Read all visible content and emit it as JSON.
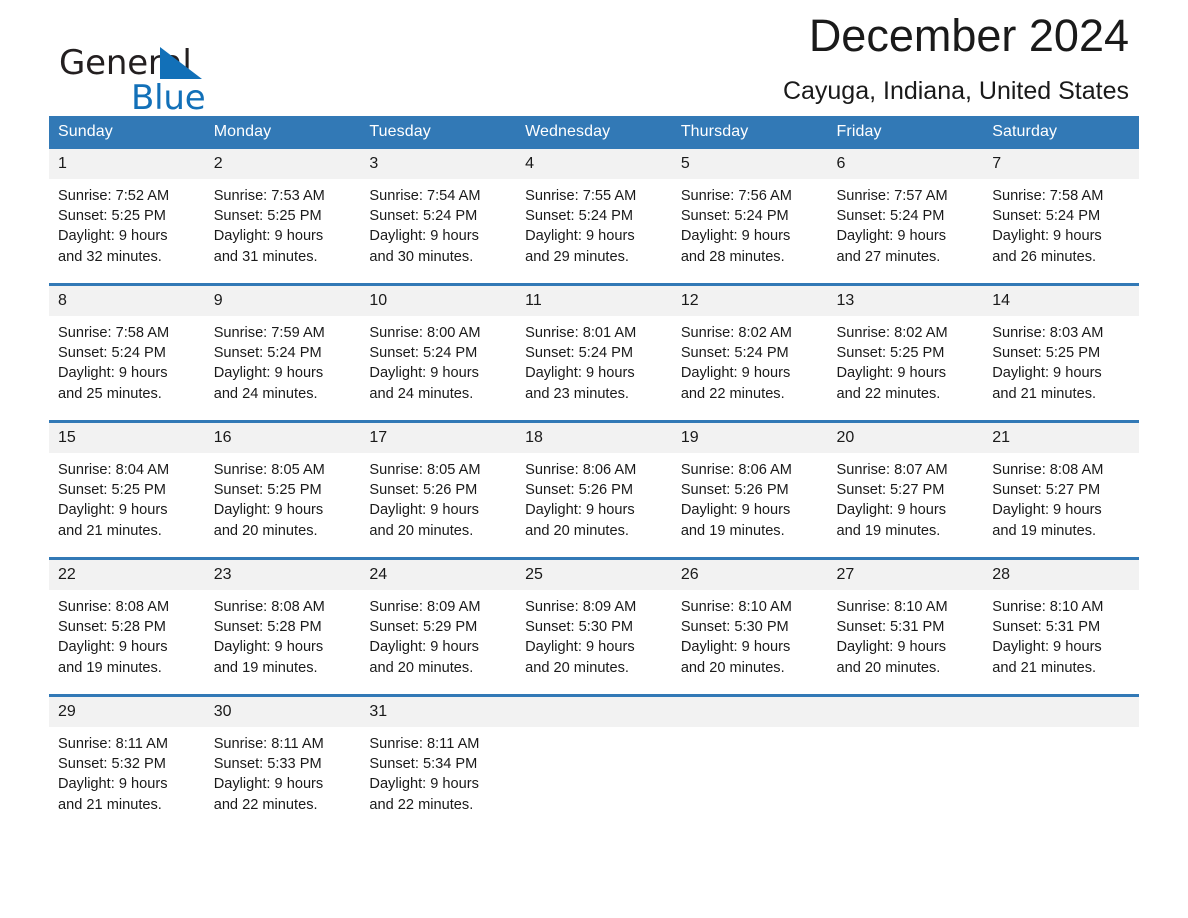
{
  "brand": {
    "name_top": "General",
    "name_bottom": "Blue",
    "color_black": "#231f20",
    "color_blue": "#1270b8"
  },
  "header": {
    "title": "December 2024",
    "subtitle": "Cayuga, Indiana, United States"
  },
  "theme": {
    "header_blue": "#3279b6",
    "daynum_gray": "#f2f2f2",
    "text": "#1a1a1a"
  },
  "weekdays": [
    "Sunday",
    "Monday",
    "Tuesday",
    "Wednesday",
    "Thursday",
    "Friday",
    "Saturday"
  ],
  "weeks": [
    [
      {
        "day": "1",
        "sunrise": "Sunrise: 7:52 AM",
        "sunset": "Sunset: 5:25 PM",
        "daylight1": "Daylight: 9 hours",
        "daylight2": "and 32 minutes."
      },
      {
        "day": "2",
        "sunrise": "Sunrise: 7:53 AM",
        "sunset": "Sunset: 5:25 PM",
        "daylight1": "Daylight: 9 hours",
        "daylight2": "and 31 minutes."
      },
      {
        "day": "3",
        "sunrise": "Sunrise: 7:54 AM",
        "sunset": "Sunset: 5:24 PM",
        "daylight1": "Daylight: 9 hours",
        "daylight2": "and 30 minutes."
      },
      {
        "day": "4",
        "sunrise": "Sunrise: 7:55 AM",
        "sunset": "Sunset: 5:24 PM",
        "daylight1": "Daylight: 9 hours",
        "daylight2": "and 29 minutes."
      },
      {
        "day": "5",
        "sunrise": "Sunrise: 7:56 AM",
        "sunset": "Sunset: 5:24 PM",
        "daylight1": "Daylight: 9 hours",
        "daylight2": "and 28 minutes."
      },
      {
        "day": "6",
        "sunrise": "Sunrise: 7:57 AM",
        "sunset": "Sunset: 5:24 PM",
        "daylight1": "Daylight: 9 hours",
        "daylight2": "and 27 minutes."
      },
      {
        "day": "7",
        "sunrise": "Sunrise: 7:58 AM",
        "sunset": "Sunset: 5:24 PM",
        "daylight1": "Daylight: 9 hours",
        "daylight2": "and 26 minutes."
      }
    ],
    [
      {
        "day": "8",
        "sunrise": "Sunrise: 7:58 AM",
        "sunset": "Sunset: 5:24 PM",
        "daylight1": "Daylight: 9 hours",
        "daylight2": "and 25 minutes."
      },
      {
        "day": "9",
        "sunrise": "Sunrise: 7:59 AM",
        "sunset": "Sunset: 5:24 PM",
        "daylight1": "Daylight: 9 hours",
        "daylight2": "and 24 minutes."
      },
      {
        "day": "10",
        "sunrise": "Sunrise: 8:00 AM",
        "sunset": "Sunset: 5:24 PM",
        "daylight1": "Daylight: 9 hours",
        "daylight2": "and 24 minutes."
      },
      {
        "day": "11",
        "sunrise": "Sunrise: 8:01 AM",
        "sunset": "Sunset: 5:24 PM",
        "daylight1": "Daylight: 9 hours",
        "daylight2": "and 23 minutes."
      },
      {
        "day": "12",
        "sunrise": "Sunrise: 8:02 AM",
        "sunset": "Sunset: 5:24 PM",
        "daylight1": "Daylight: 9 hours",
        "daylight2": "and 22 minutes."
      },
      {
        "day": "13",
        "sunrise": "Sunrise: 8:02 AM",
        "sunset": "Sunset: 5:25 PM",
        "daylight1": "Daylight: 9 hours",
        "daylight2": "and 22 minutes."
      },
      {
        "day": "14",
        "sunrise": "Sunrise: 8:03 AM",
        "sunset": "Sunset: 5:25 PM",
        "daylight1": "Daylight: 9 hours",
        "daylight2": "and 21 minutes."
      }
    ],
    [
      {
        "day": "15",
        "sunrise": "Sunrise: 8:04 AM",
        "sunset": "Sunset: 5:25 PM",
        "daylight1": "Daylight: 9 hours",
        "daylight2": "and 21 minutes."
      },
      {
        "day": "16",
        "sunrise": "Sunrise: 8:05 AM",
        "sunset": "Sunset: 5:25 PM",
        "daylight1": "Daylight: 9 hours",
        "daylight2": "and 20 minutes."
      },
      {
        "day": "17",
        "sunrise": "Sunrise: 8:05 AM",
        "sunset": "Sunset: 5:26 PM",
        "daylight1": "Daylight: 9 hours",
        "daylight2": "and 20 minutes."
      },
      {
        "day": "18",
        "sunrise": "Sunrise: 8:06 AM",
        "sunset": "Sunset: 5:26 PM",
        "daylight1": "Daylight: 9 hours",
        "daylight2": "and 20 minutes."
      },
      {
        "day": "19",
        "sunrise": "Sunrise: 8:06 AM",
        "sunset": "Sunset: 5:26 PM",
        "daylight1": "Daylight: 9 hours",
        "daylight2": "and 19 minutes."
      },
      {
        "day": "20",
        "sunrise": "Sunrise: 8:07 AM",
        "sunset": "Sunset: 5:27 PM",
        "daylight1": "Daylight: 9 hours",
        "daylight2": "and 19 minutes."
      },
      {
        "day": "21",
        "sunrise": "Sunrise: 8:08 AM",
        "sunset": "Sunset: 5:27 PM",
        "daylight1": "Daylight: 9 hours",
        "daylight2": "and 19 minutes."
      }
    ],
    [
      {
        "day": "22",
        "sunrise": "Sunrise: 8:08 AM",
        "sunset": "Sunset: 5:28 PM",
        "daylight1": "Daylight: 9 hours",
        "daylight2": "and 19 minutes."
      },
      {
        "day": "23",
        "sunrise": "Sunrise: 8:08 AM",
        "sunset": "Sunset: 5:28 PM",
        "daylight1": "Daylight: 9 hours",
        "daylight2": "and 19 minutes."
      },
      {
        "day": "24",
        "sunrise": "Sunrise: 8:09 AM",
        "sunset": "Sunset: 5:29 PM",
        "daylight1": "Daylight: 9 hours",
        "daylight2": "and 20 minutes."
      },
      {
        "day": "25",
        "sunrise": "Sunrise: 8:09 AM",
        "sunset": "Sunset: 5:30 PM",
        "daylight1": "Daylight: 9 hours",
        "daylight2": "and 20 minutes."
      },
      {
        "day": "26",
        "sunrise": "Sunrise: 8:10 AM",
        "sunset": "Sunset: 5:30 PM",
        "daylight1": "Daylight: 9 hours",
        "daylight2": "and 20 minutes."
      },
      {
        "day": "27",
        "sunrise": "Sunrise: 8:10 AM",
        "sunset": "Sunset: 5:31 PM",
        "daylight1": "Daylight: 9 hours",
        "daylight2": "and 20 minutes."
      },
      {
        "day": "28",
        "sunrise": "Sunrise: 8:10 AM",
        "sunset": "Sunset: 5:31 PM",
        "daylight1": "Daylight: 9 hours",
        "daylight2": "and 21 minutes."
      }
    ],
    [
      {
        "day": "29",
        "sunrise": "Sunrise: 8:11 AM",
        "sunset": "Sunset: 5:32 PM",
        "daylight1": "Daylight: 9 hours",
        "daylight2": "and 21 minutes."
      },
      {
        "day": "30",
        "sunrise": "Sunrise: 8:11 AM",
        "sunset": "Sunset: 5:33 PM",
        "daylight1": "Daylight: 9 hours",
        "daylight2": "and 22 minutes."
      },
      {
        "day": "31",
        "sunrise": "Sunrise: 8:11 AM",
        "sunset": "Sunset: 5:34 PM",
        "daylight1": "Daylight: 9 hours",
        "daylight2": "and 22 minutes."
      },
      {
        "day": "",
        "sunrise": "",
        "sunset": "",
        "daylight1": "",
        "daylight2": ""
      },
      {
        "day": "",
        "sunrise": "",
        "sunset": "",
        "daylight1": "",
        "daylight2": ""
      },
      {
        "day": "",
        "sunrise": "",
        "sunset": "",
        "daylight1": "",
        "daylight2": ""
      },
      {
        "day": "",
        "sunrise": "",
        "sunset": "",
        "daylight1": "",
        "daylight2": ""
      }
    ]
  ]
}
